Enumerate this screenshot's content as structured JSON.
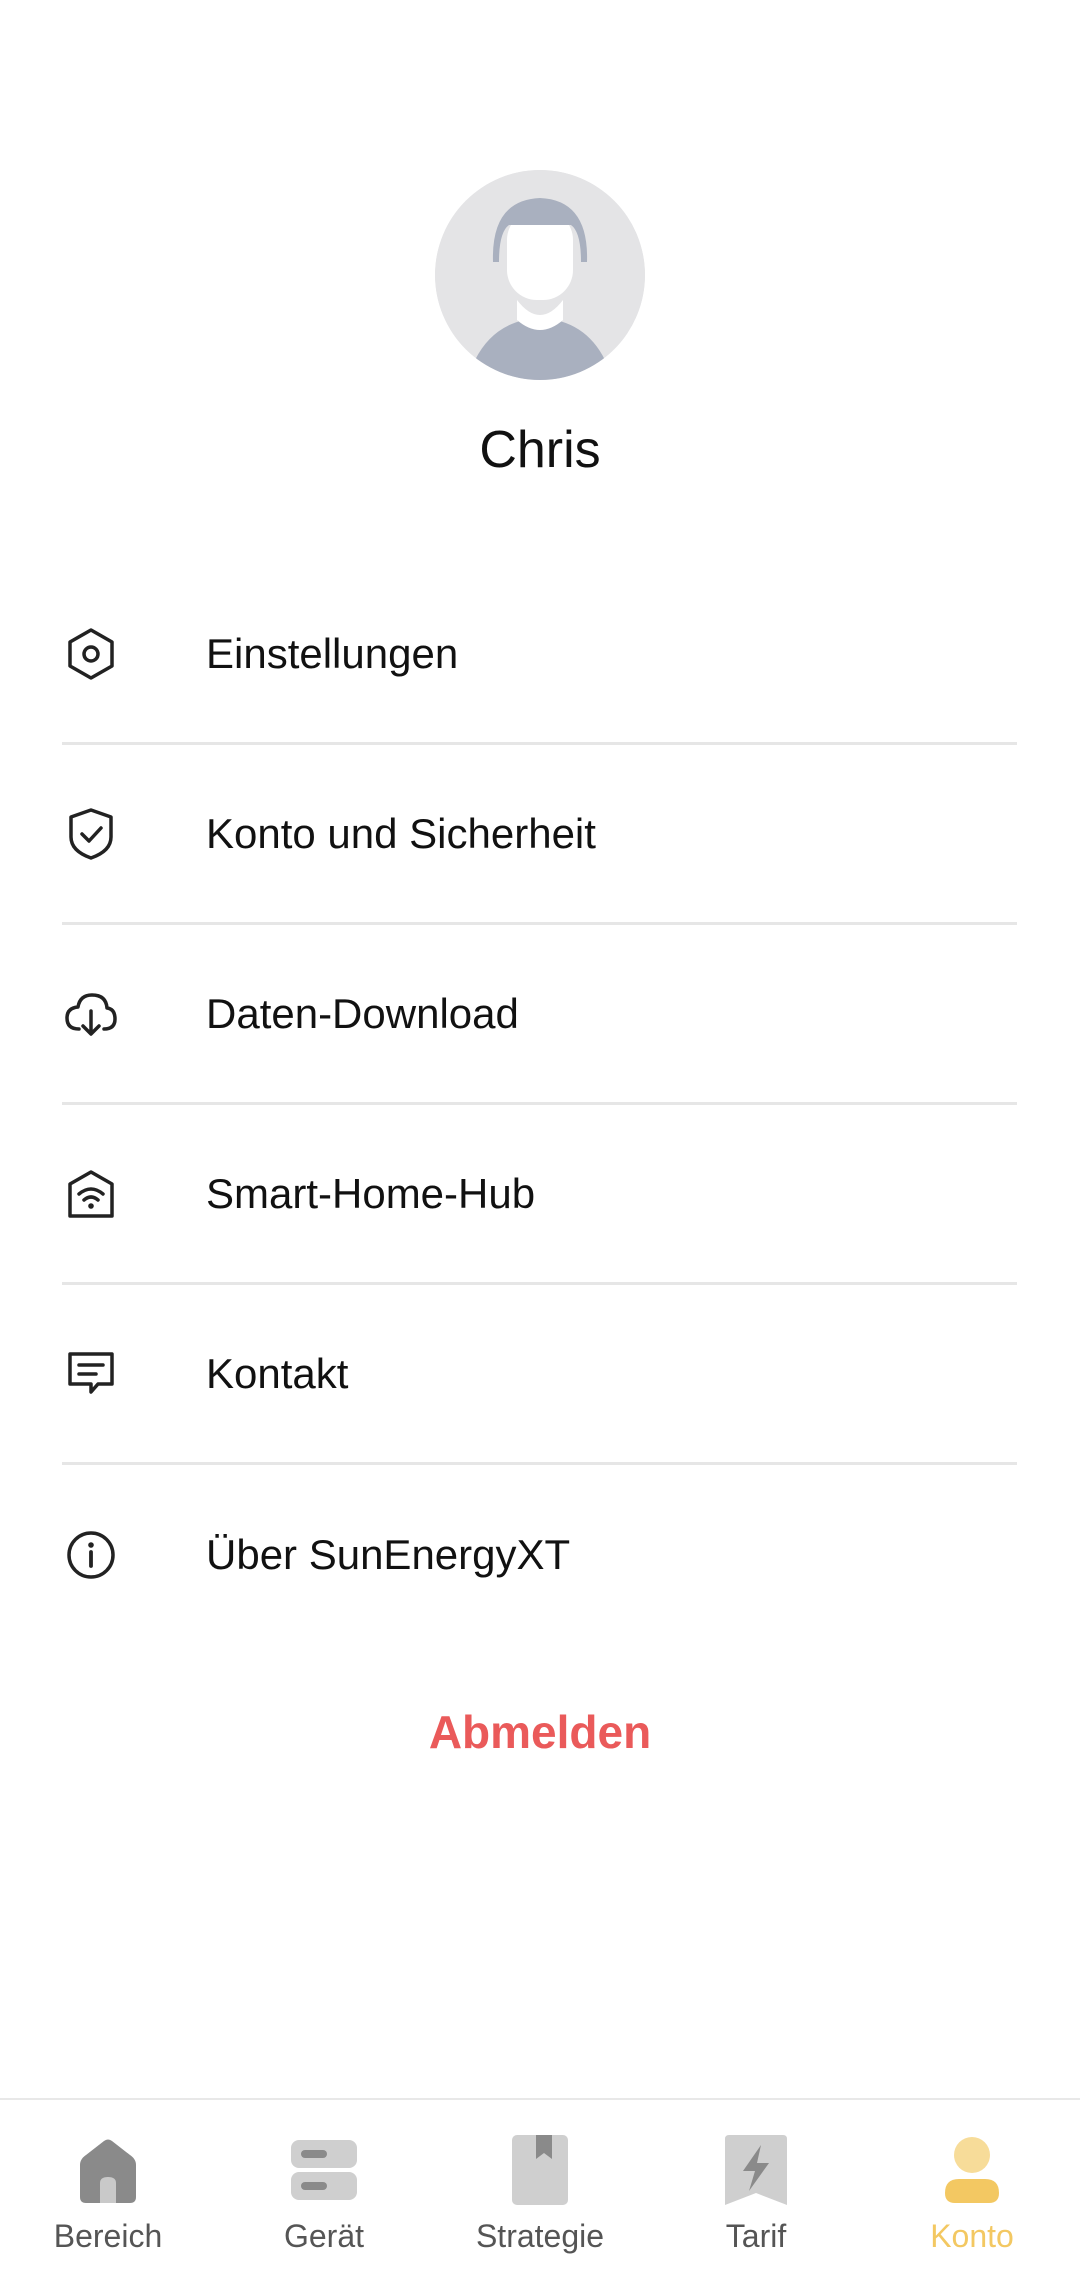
{
  "profile": {
    "name": "Chris"
  },
  "menu": {
    "items": [
      {
        "label": "Einstellungen",
        "icon": "settings-hexagon-icon"
      },
      {
        "label": "Konto und Sicherheit",
        "icon": "shield-check-icon"
      },
      {
        "label": "Daten-Download",
        "icon": "cloud-download-icon"
      },
      {
        "label": "Smart-Home-Hub",
        "icon": "home-wifi-icon"
      },
      {
        "label": "Kontakt",
        "icon": "message-icon"
      },
      {
        "label": "Über SunEnergyXT",
        "icon": "info-icon"
      }
    ]
  },
  "logout": {
    "label": "Abmelden",
    "color": "#ea5a5a"
  },
  "tabbar": {
    "active": "Konto",
    "accent": "#f3c862",
    "tabs": [
      {
        "label": "Bereich",
        "icon": "home-icon"
      },
      {
        "label": "Gerät",
        "icon": "device-icon"
      },
      {
        "label": "Strategie",
        "icon": "strategy-icon"
      },
      {
        "label": "Tarif",
        "icon": "tariff-icon"
      },
      {
        "label": "Konto",
        "icon": "account-icon"
      }
    ]
  }
}
